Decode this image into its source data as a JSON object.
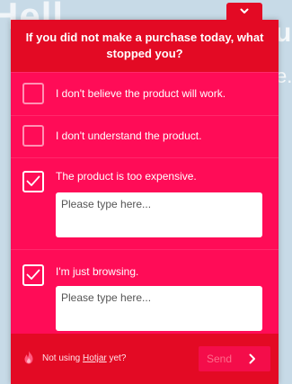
{
  "background": {
    "heading_fragment": "Hell",
    "right_fragment_top": "u",
    "right_fragment_mid": "e."
  },
  "widget": {
    "toggle_icon": "chevron-down-icon",
    "question": "If you did not make a purchase today, what stopped you?",
    "options": [
      {
        "label": "I don't believe the product will work.",
        "checked": false
      },
      {
        "label": "I don't understand the product.",
        "checked": false
      },
      {
        "label": "The product is too expensive.",
        "checked": true,
        "placeholder": "Please type here..."
      },
      {
        "label": "I'm just browsing.",
        "checked": true,
        "placeholder": "Please type here..."
      }
    ],
    "footer": {
      "icon": "hotjar-flame-icon",
      "prefix": "Not using ",
      "link": "Hotjar",
      "suffix": " yet?",
      "send_label": "Send",
      "send_icon": "chevron-right-icon"
    },
    "colors": {
      "header": "#e30a24",
      "body": "#ff0c57",
      "send_button": "#f40d4a",
      "page_background": "#c7dae7"
    }
  }
}
